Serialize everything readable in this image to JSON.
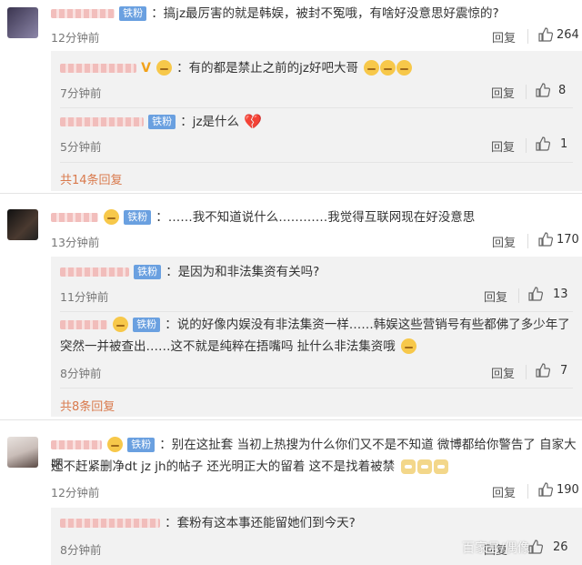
{
  "comments": [
    {
      "badge": "铁粉",
      "text": "：搞jz最厉害的就是韩娱，被封不冤哦，有啥好没意思好震惊的?",
      "time": "12分钟前",
      "reply_label": "回复",
      "likes": "264",
      "replies": [
        {
          "badge": "",
          "text": "：有的都是禁止之前的jz好吧大哥",
          "time": "7分钟前",
          "reply_label": "回复",
          "likes": "8"
        },
        {
          "badge": "铁粉",
          "text": "：jz是什么",
          "time": "5分钟前",
          "reply_label": "回复",
          "likes": "1"
        }
      ],
      "more_text": "共14条回复"
    },
    {
      "badge": "铁粉",
      "text": "：……我不知道说什么…………我觉得互联网现在好没意思",
      "time": "13分钟前",
      "reply_label": "回复",
      "likes": "170",
      "replies": [
        {
          "badge": "铁粉",
          "text": "：是因为和非法集资有关吗?",
          "time": "11分钟前",
          "reply_label": "回复",
          "likes": "13"
        },
        {
          "badge": "铁粉",
          "text_line1": "：说的好像内娱没有非法集资一样……韩娱这些营销号有些都佛了多少年了",
          "text_line2": "突然一并被查出……这不就是纯粹在捂嘴吗 扯什么非法集资哦",
          "time": "8分钟前",
          "reply_label": "回复",
          "likes": "7"
        }
      ],
      "more_text": "共8条回复"
    },
    {
      "badge": "铁粉",
      "text_line1": "：别在这扯套  当初上热搜为什么你们又不是不知道  微博都给你警告了  自家大吧",
      "text_line2": "还不赶紧删净dt jz jh的帖子  还光明正大的留着  这不是找着被禁",
      "time": "12分钟前",
      "reply_label": "回复",
      "likes": "190",
      "replies": [
        {
          "badge": "",
          "text": "：套粉有这本事还能留她们到今天?",
          "time": "8分钟前",
          "reply_label": "回复",
          "likes": "26"
        }
      ]
    }
  ],
  "watermark": "百家号/偶像"
}
